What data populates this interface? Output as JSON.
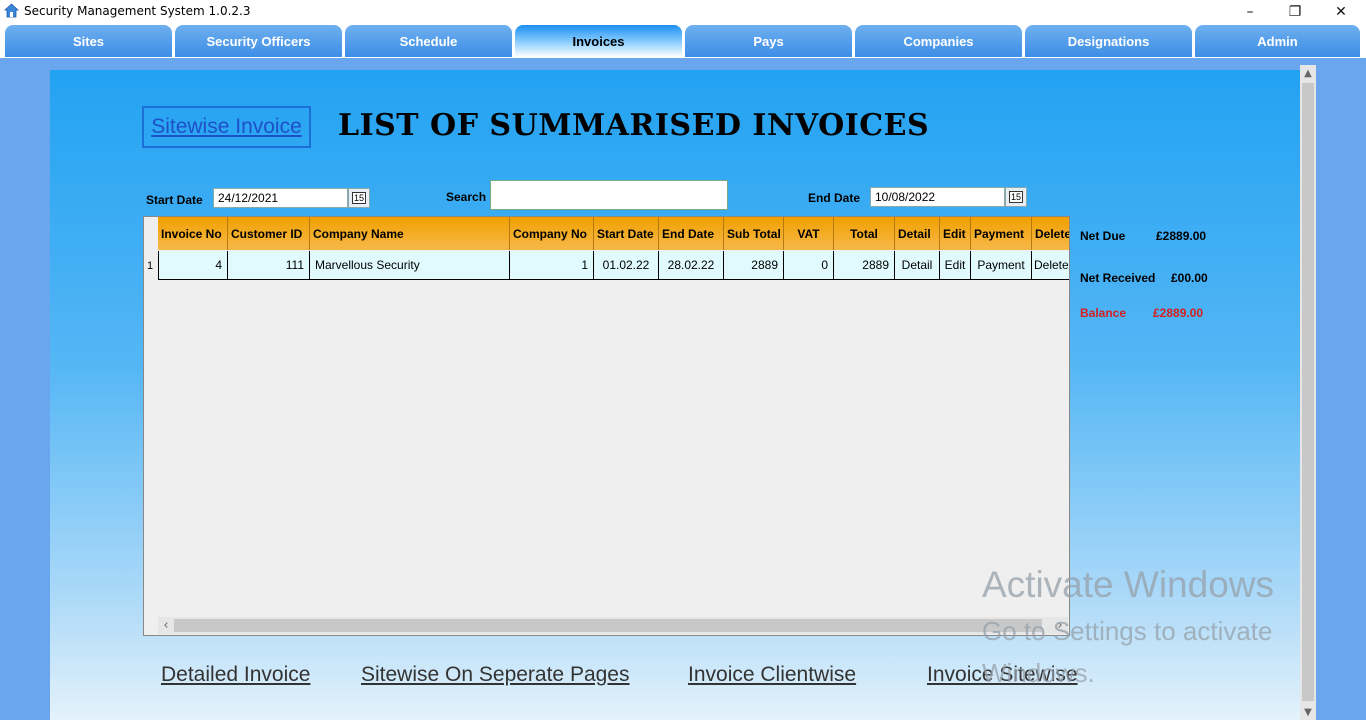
{
  "window": {
    "title": "Security Management System 1.0.2.3",
    "controls": {
      "minimize": "–",
      "restore": "❐",
      "close": "✕"
    }
  },
  "tabs": [
    {
      "label": "Sites"
    },
    {
      "label": "Security Officers"
    },
    {
      "label": "Schedule"
    },
    {
      "label": "Invoices"
    },
    {
      "label": "Pays"
    },
    {
      "label": "Companies"
    },
    {
      "label": "Designations"
    },
    {
      "label": "Admin"
    }
  ],
  "active_tab": "Invoices",
  "page": {
    "sitewise_link": "Sitewise Invoice",
    "heading": "LIST OF SUMMARISED INVOICES"
  },
  "filters": {
    "start_date_label": "Start Date",
    "start_date": "24/12/2021",
    "search_label": "Search",
    "search_value": "",
    "end_date_label": "End Date",
    "end_date": "10/08/2022",
    "calendar_glyph": "15"
  },
  "table": {
    "columns": [
      "Invoice No",
      "Customer ID",
      "Company Name",
      "Company No",
      "Start Date",
      "End Date",
      "Sub Total",
      "VAT",
      "Total",
      "Detail",
      "Edit",
      "Payment",
      "Delete"
    ],
    "rows": [
      {
        "row_header": "1",
        "cells": [
          "4",
          "111",
          "Marvellous Security",
          "1",
          "01.02.22",
          "28.02.22",
          "2889",
          "0",
          "2889",
          "Detail",
          "Edit",
          "Payment",
          "Delete"
        ]
      }
    ],
    "scroll_left": "‹",
    "scroll_right": "›"
  },
  "summary": {
    "net_due_label": "Net Due",
    "net_due": "£2889.00",
    "net_received_label": "Net Received",
    "net_received": "£00.00",
    "balance_label": "Balance",
    "balance": "£2889.00",
    "balance_color": "#d42020"
  },
  "bottom_links": [
    "Detailed Invoice",
    "Sitewise On Seperate Pages",
    "Invoice Clientwise",
    "Invoice Sitewise"
  ],
  "watermark": {
    "line1": "Activate Windows",
    "line2": "Go to Settings to activate",
    "line3": "Windows."
  },
  "colors": {
    "tab": "#3d8de6",
    "header": "#f0a000",
    "content": "#22a2f2",
    "row": "#e0fafe"
  }
}
